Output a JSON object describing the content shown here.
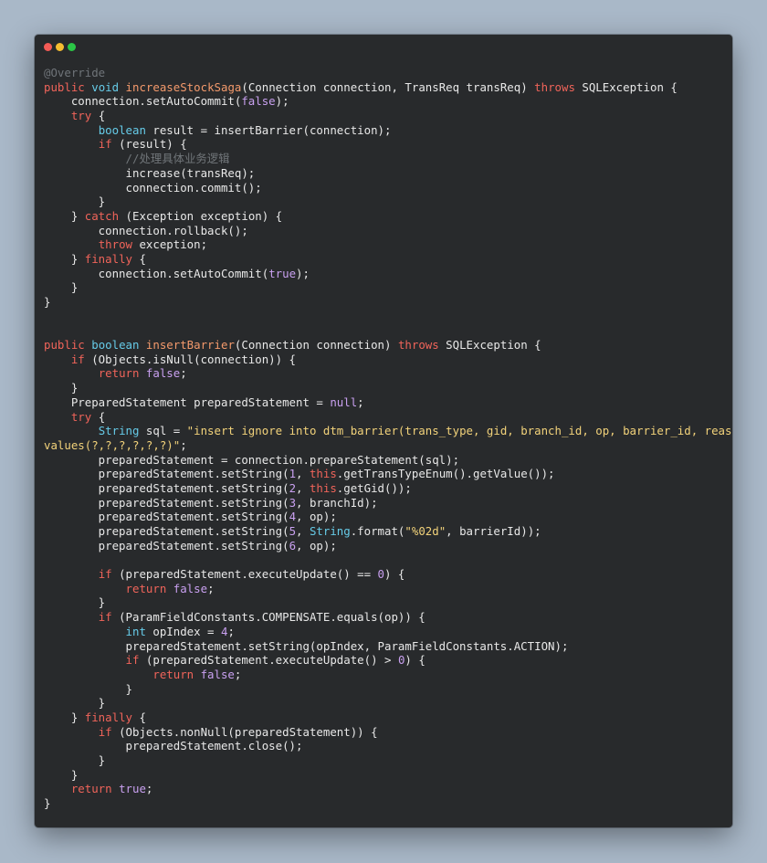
{
  "window": {
    "controls": [
      {
        "name": "close",
        "color": "#f35b56"
      },
      {
        "name": "minimize",
        "color": "#f6bd30"
      },
      {
        "name": "maximize",
        "color": "#2bc646"
      }
    ]
  },
  "colors": {
    "background": "#a9b8c8",
    "editor": "#282a2c",
    "plain": "#e8e8e8",
    "keyword": "#f0645a",
    "type": "#66cbe8",
    "function": "#f49a6c",
    "literal": "#c9a0f0",
    "string": "#f2d27a",
    "annotation": "#6f7479",
    "comment": "#707579"
  },
  "code_lines": [
    [
      [
        "ann",
        "@Override"
      ]
    ],
    [
      [
        "kw",
        "public"
      ],
      [
        "plain",
        " "
      ],
      [
        "type",
        "void"
      ],
      [
        "plain",
        " "
      ],
      [
        "fn",
        "increaseStockSaga"
      ],
      [
        "plain",
        "(Connection connection, TransReq transReq) "
      ],
      [
        "kw",
        "throws"
      ],
      [
        "plain",
        " SQLException {"
      ]
    ],
    [
      [
        "plain",
        "    connection.setAutoCommit("
      ],
      [
        "lit",
        "false"
      ],
      [
        "plain",
        ");"
      ]
    ],
    [
      [
        "plain",
        "    "
      ],
      [
        "kw",
        "try"
      ],
      [
        "plain",
        " {"
      ]
    ],
    [
      [
        "plain",
        "        "
      ],
      [
        "type",
        "boolean"
      ],
      [
        "plain",
        " result = insertBarrier(connection);"
      ]
    ],
    [
      [
        "plain",
        "        "
      ],
      [
        "kw",
        "if"
      ],
      [
        "plain",
        " (result) {"
      ]
    ],
    [
      [
        "plain",
        "            "
      ],
      [
        "com",
        "//处理具体业务逻辑"
      ]
    ],
    [
      [
        "plain",
        "            increase(transReq);"
      ]
    ],
    [
      [
        "plain",
        "            connection.commit();"
      ]
    ],
    [
      [
        "plain",
        "        }"
      ]
    ],
    [
      [
        "plain",
        "    } "
      ],
      [
        "kw",
        "catch"
      ],
      [
        "plain",
        " (Exception exception) {"
      ]
    ],
    [
      [
        "plain",
        "        connection.rollback();"
      ]
    ],
    [
      [
        "plain",
        "        "
      ],
      [
        "kw",
        "throw"
      ],
      [
        "plain",
        " exception;"
      ]
    ],
    [
      [
        "plain",
        "    } "
      ],
      [
        "kw",
        "finally"
      ],
      [
        "plain",
        " {"
      ]
    ],
    [
      [
        "plain",
        "        connection.setAutoCommit("
      ],
      [
        "lit",
        "true"
      ],
      [
        "plain",
        ");"
      ]
    ],
    [
      [
        "plain",
        "    }"
      ]
    ],
    [
      [
        "plain",
        "}"
      ]
    ],
    [],
    [],
    [
      [
        "kw",
        "public"
      ],
      [
        "plain",
        " "
      ],
      [
        "type",
        "boolean"
      ],
      [
        "plain",
        " "
      ],
      [
        "fn",
        "insertBarrier"
      ],
      [
        "plain",
        "(Connection connection) "
      ],
      [
        "kw",
        "throws"
      ],
      [
        "plain",
        " SQLException {"
      ]
    ],
    [
      [
        "plain",
        "    "
      ],
      [
        "kw",
        "if"
      ],
      [
        "plain",
        " (Objects.isNull(connection)) {"
      ]
    ],
    [
      [
        "plain",
        "        "
      ],
      [
        "kw",
        "return"
      ],
      [
        "plain",
        " "
      ],
      [
        "lit",
        "false"
      ],
      [
        "plain",
        ";"
      ]
    ],
    [
      [
        "plain",
        "    }"
      ]
    ],
    [
      [
        "plain",
        "    PreparedStatement preparedStatement = "
      ],
      [
        "lit",
        "null"
      ],
      [
        "plain",
        ";"
      ]
    ],
    [
      [
        "plain",
        "    "
      ],
      [
        "kw",
        "try"
      ],
      [
        "plain",
        " {"
      ]
    ],
    [
      [
        "plain",
        "        "
      ],
      [
        "type",
        "String"
      ],
      [
        "plain",
        " sql = "
      ],
      [
        "str",
        "\"insert ignore into dtm_barrier(trans_type, gid, branch_id, op, barrier_id, reason)"
      ]
    ],
    [
      [
        "str",
        "values(?,?,?,?,?,?)\""
      ],
      [
        "plain",
        ";"
      ]
    ],
    [
      [
        "plain",
        "        preparedStatement = connection.prepareStatement(sql);"
      ]
    ],
    [
      [
        "plain",
        "        preparedStatement.setString("
      ],
      [
        "lit",
        "1"
      ],
      [
        "plain",
        ", "
      ],
      [
        "kw",
        "this"
      ],
      [
        "plain",
        ".getTransTypeEnum().getValue());"
      ]
    ],
    [
      [
        "plain",
        "        preparedStatement.setString("
      ],
      [
        "lit",
        "2"
      ],
      [
        "plain",
        ", "
      ],
      [
        "kw",
        "this"
      ],
      [
        "plain",
        ".getGid());"
      ]
    ],
    [
      [
        "plain",
        "        preparedStatement.setString("
      ],
      [
        "lit",
        "3"
      ],
      [
        "plain",
        ", branchId);"
      ]
    ],
    [
      [
        "plain",
        "        preparedStatement.setString("
      ],
      [
        "lit",
        "4"
      ],
      [
        "plain",
        ", op);"
      ]
    ],
    [
      [
        "plain",
        "        preparedStatement.setString("
      ],
      [
        "lit",
        "5"
      ],
      [
        "plain",
        ", "
      ],
      [
        "type",
        "String"
      ],
      [
        "plain",
        ".format("
      ],
      [
        "str",
        "\"%02d\""
      ],
      [
        "plain",
        ", barrierId));"
      ]
    ],
    [
      [
        "plain",
        "        preparedStatement.setString("
      ],
      [
        "lit",
        "6"
      ],
      [
        "plain",
        ", op);"
      ]
    ],
    [],
    [
      [
        "plain",
        "        "
      ],
      [
        "kw",
        "if"
      ],
      [
        "plain",
        " (preparedStatement.executeUpdate() == "
      ],
      [
        "lit",
        "0"
      ],
      [
        "plain",
        ") {"
      ]
    ],
    [
      [
        "plain",
        "            "
      ],
      [
        "kw",
        "return"
      ],
      [
        "plain",
        " "
      ],
      [
        "lit",
        "false"
      ],
      [
        "plain",
        ";"
      ]
    ],
    [
      [
        "plain",
        "        }"
      ]
    ],
    [
      [
        "plain",
        "        "
      ],
      [
        "kw",
        "if"
      ],
      [
        "plain",
        " (ParamFieldConstants.COMPENSATE.equals(op)) {"
      ]
    ],
    [
      [
        "plain",
        "            "
      ],
      [
        "type",
        "int"
      ],
      [
        "plain",
        " opIndex = "
      ],
      [
        "lit",
        "4"
      ],
      [
        "plain",
        ";"
      ]
    ],
    [
      [
        "plain",
        "            preparedStatement.setString(opIndex, ParamFieldConstants.ACTION);"
      ]
    ],
    [
      [
        "plain",
        "            "
      ],
      [
        "kw",
        "if"
      ],
      [
        "plain",
        " (preparedStatement.executeUpdate() > "
      ],
      [
        "lit",
        "0"
      ],
      [
        "plain",
        ") {"
      ]
    ],
    [
      [
        "plain",
        "                "
      ],
      [
        "kw",
        "return"
      ],
      [
        "plain",
        " "
      ],
      [
        "lit",
        "false"
      ],
      [
        "plain",
        ";"
      ]
    ],
    [
      [
        "plain",
        "            }"
      ]
    ],
    [
      [
        "plain",
        "        }"
      ]
    ],
    [
      [
        "plain",
        "    } "
      ],
      [
        "kw",
        "finally"
      ],
      [
        "plain",
        " {"
      ]
    ],
    [
      [
        "plain",
        "        "
      ],
      [
        "kw",
        "if"
      ],
      [
        "plain",
        " (Objects.nonNull(preparedStatement)) {"
      ]
    ],
    [
      [
        "plain",
        "            preparedStatement.close();"
      ]
    ],
    [
      [
        "plain",
        "        }"
      ]
    ],
    [
      [
        "plain",
        "    }"
      ]
    ],
    [
      [
        "plain",
        "    "
      ],
      [
        "kw",
        "return"
      ],
      [
        "plain",
        " "
      ],
      [
        "lit",
        "true"
      ],
      [
        "plain",
        ";"
      ]
    ],
    [
      [
        "plain",
        "}"
      ]
    ]
  ]
}
